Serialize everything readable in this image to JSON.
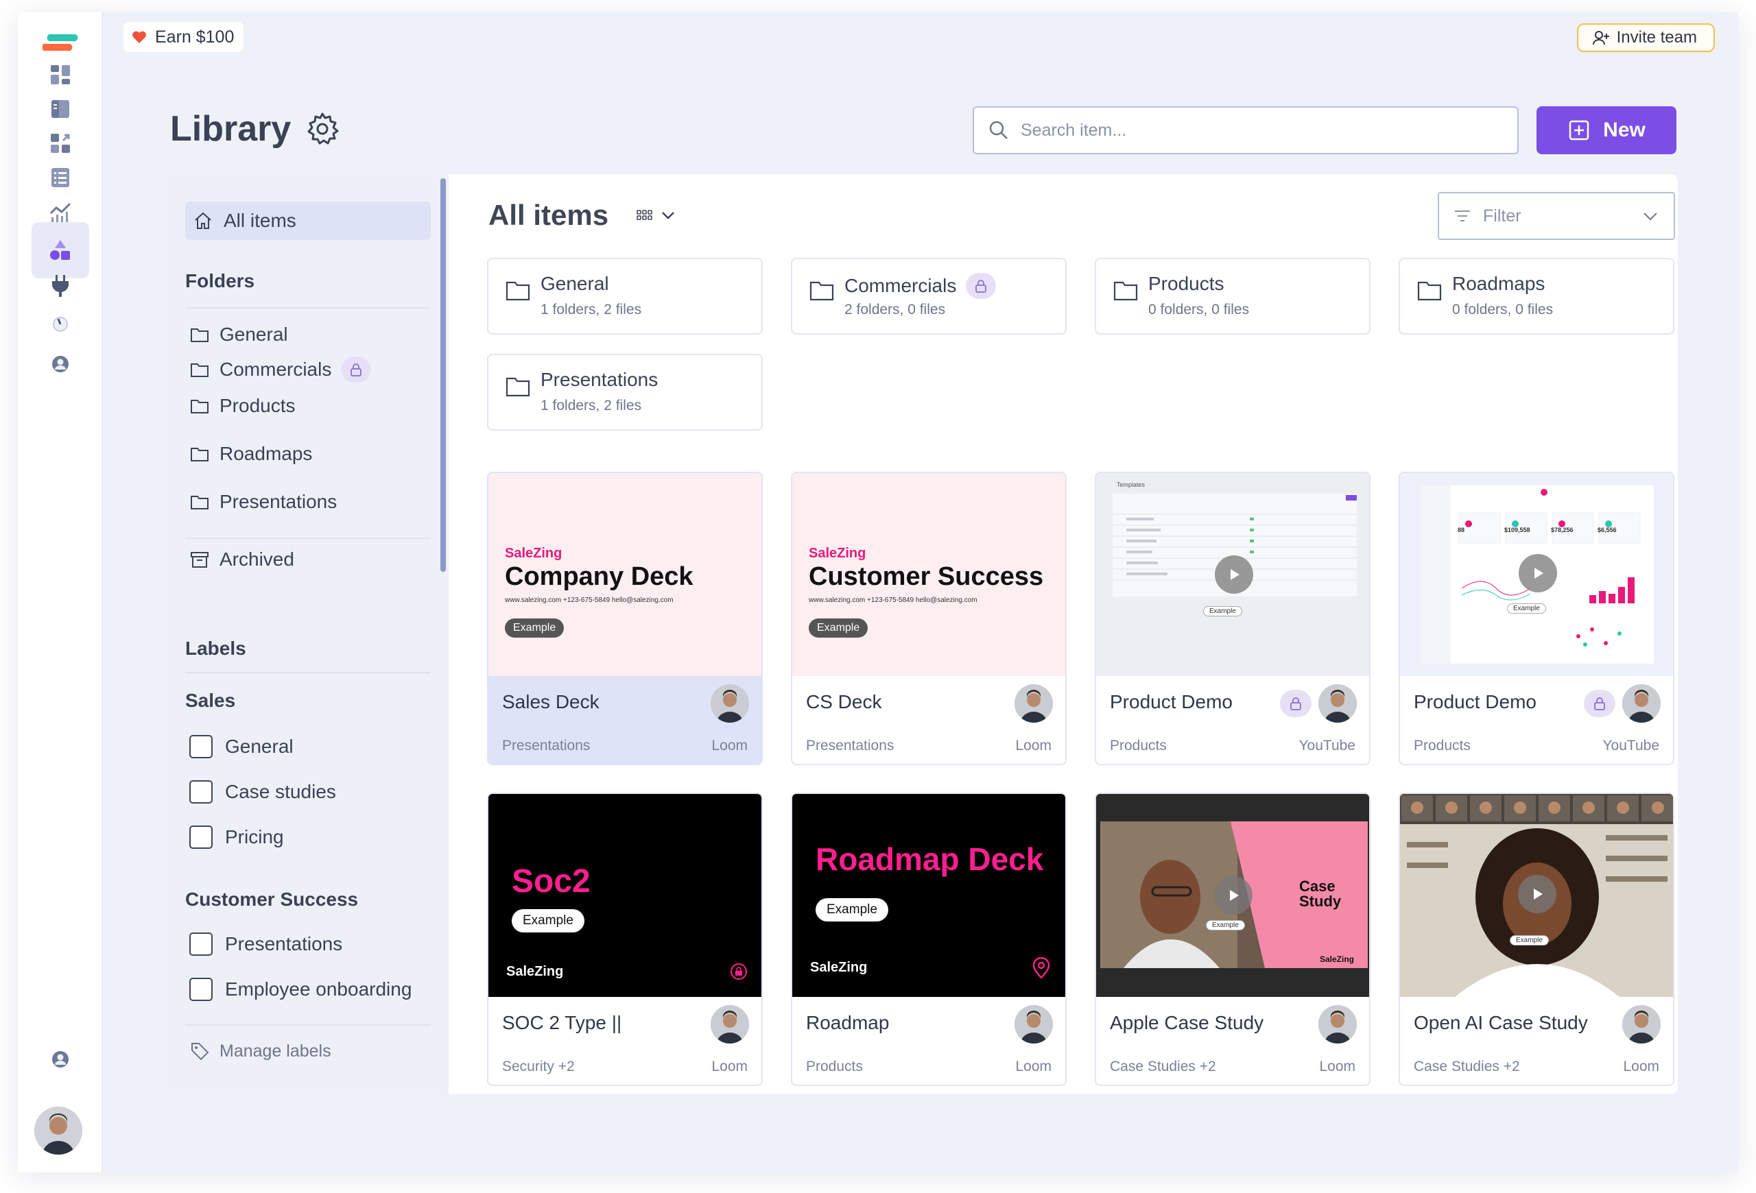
{
  "topbar": {
    "earn_label": "Earn $100",
    "invite_label": "Invite team"
  },
  "header": {
    "title": "Library",
    "search_placeholder": "Search item...",
    "new_label": "New"
  },
  "sidebar": {
    "all_items": "All items",
    "folders_heading": "Folders",
    "folders": [
      {
        "label": "General",
        "locked": false
      },
      {
        "label": "Commercials",
        "locked": true
      },
      {
        "label": "Products",
        "locked": false
      },
      {
        "label": "Roadmaps",
        "locked": false
      },
      {
        "label": "Presentations",
        "locked": false
      }
    ],
    "archived": "Archived",
    "labels_heading": "Labels",
    "groups": [
      {
        "heading": "Sales",
        "items": [
          "General",
          "Case studies",
          "Pricing"
        ]
      },
      {
        "heading": "Customer Success",
        "items": [
          "Presentations",
          "Employee onboarding"
        ]
      }
    ],
    "manage_labels": "Manage labels"
  },
  "main": {
    "heading": "All items",
    "filter_placeholder": "Filter",
    "folders": [
      {
        "name": "General",
        "meta": "1 folders, 2 files",
        "locked": false
      },
      {
        "name": "Commercials",
        "meta": "2 folders, 0 files",
        "locked": true
      },
      {
        "name": "Products",
        "meta": "0 folders, 0 files",
        "locked": false
      },
      {
        "name": "Roadmaps",
        "meta": "0 folders, 0 files",
        "locked": false
      },
      {
        "name": "Presentations",
        "meta": "1 folders, 2 files",
        "locked": false
      }
    ],
    "cards": [
      {
        "name": "Sales Deck",
        "category": "Presentations",
        "source": "Loom",
        "locked": false,
        "selected": true,
        "thumb": {
          "brand": "SaleZing",
          "title": "Company Deck",
          "contact": "www.salezing.com   +123-675-5849   hello@salezing.com",
          "tag": "Example"
        }
      },
      {
        "name": "CS Deck",
        "category": "Presentations",
        "source": "Loom",
        "locked": false,
        "thumb": {
          "brand": "SaleZing",
          "title": "Customer Success",
          "contact": "www.salezing.com   +123-675-5849   hello@salezing.com",
          "tag": "Example"
        }
      },
      {
        "name": "Product Demo",
        "category": "Products",
        "source": "YouTube",
        "locked": true,
        "thumb": {
          "tag": "Example",
          "heading": "Templates"
        }
      },
      {
        "name": "Product Demo",
        "category": "Products",
        "source": "YouTube",
        "locked": true,
        "thumb": {
          "tag": "Example",
          "stats": [
            "88",
            "$109,558",
            "$78,256",
            "$6,556"
          ]
        }
      },
      {
        "name": "SOC 2 Type ||",
        "category": "Security +2",
        "source": "Loom",
        "locked": false,
        "thumb": {
          "title": "Soc2",
          "tag": "Example",
          "brand": "SaleZing"
        }
      },
      {
        "name": "Roadmap",
        "category": "Products",
        "source": "Loom",
        "locked": false,
        "thumb": {
          "title": "Roadmap Deck",
          "tag": "Example",
          "brand": "SaleZing"
        }
      },
      {
        "name": "Apple Case Study",
        "category": "Case Studies +2",
        "source": "Loom",
        "locked": false,
        "thumb": {
          "title": "Case Study",
          "tag": "Example",
          "brand": "SaleZing"
        }
      },
      {
        "name": "Open AI Case Study",
        "category": "Case Studies +2",
        "source": "Loom",
        "locked": false,
        "thumb": {
          "tag": "Example"
        }
      }
    ]
  },
  "colors": {
    "accent": "#7b4ee4",
    "pink": "#ff1f8e",
    "selected_bg": "#dee4f7",
    "invite_border": "#f0c04a"
  }
}
